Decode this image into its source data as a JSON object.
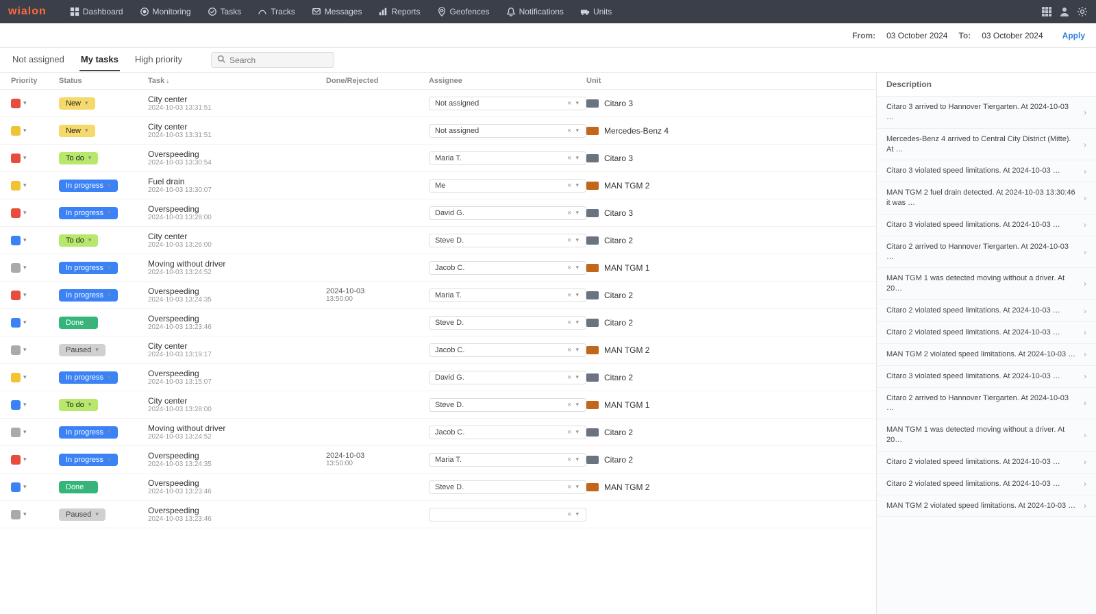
{
  "brand": "wialon",
  "nav": [
    {
      "label": "Dashboard"
    },
    {
      "label": "Monitoring"
    },
    {
      "label": "Tasks"
    },
    {
      "label": "Tracks"
    },
    {
      "label": "Messages"
    },
    {
      "label": "Reports"
    },
    {
      "label": "Geofences"
    },
    {
      "label": "Notifications"
    },
    {
      "label": "Units"
    }
  ],
  "datebar": {
    "from_label": "From:",
    "from_value": "03 October 2024",
    "to_label": "To:",
    "to_value": "03 October 2024",
    "apply": "Apply"
  },
  "tabs": {
    "not_assigned": "Not assigned",
    "my_tasks": "My tasks",
    "high_priority": "High priority"
  },
  "search_placeholder": "Search",
  "columns": {
    "priority": "Priority",
    "status": "Status",
    "task": "Task",
    "done": "Done/Rejected",
    "assignee": "Assignee",
    "unit": "Unit"
  },
  "status_labels": {
    "new": "New",
    "todo": "To do",
    "progress": "In progress",
    "done": "Done",
    "paused": "Paused"
  },
  "rows": [
    {
      "pri": "r",
      "status": "new",
      "task": "City center",
      "ts": "2024-10-03 13:31:51",
      "done": "",
      "assignee": "Not assigned",
      "unit": "Citaro 3",
      "uic": "bus"
    },
    {
      "pri": "y",
      "status": "new",
      "task": "City center",
      "ts": "2024-10-03 13:31:51",
      "done": "",
      "assignee": "Not assigned",
      "unit": "Mercedes-Benz 4",
      "uic": "van"
    },
    {
      "pri": "r",
      "status": "todo",
      "task": "Overspeeding",
      "ts": "2024-10-03 13:30:54",
      "done": "",
      "assignee": "Maria T.",
      "unit": "Citaro 3",
      "uic": "bus"
    },
    {
      "pri": "y",
      "status": "progress",
      "task": "Fuel drain",
      "ts": "2024-10-03 13:30:07",
      "done": "",
      "assignee": "Me",
      "unit": "MAN TGM 2",
      "uic": "van"
    },
    {
      "pri": "r",
      "status": "progress",
      "task": "Overspeeding",
      "ts": "2024-10-03 13:28:00",
      "done": "",
      "assignee": "David G.",
      "unit": "Citaro 3",
      "uic": "bus"
    },
    {
      "pri": "b",
      "status": "todo",
      "task": "City center",
      "ts": "2024-10-03 13:26:00",
      "done": "",
      "assignee": "Steve D.",
      "unit": "Citaro 2",
      "uic": "bus"
    },
    {
      "pri": "g",
      "status": "progress",
      "task": "Moving without driver",
      "ts": "2024-10-03 13:24:52",
      "done": "",
      "assignee": "Jacob C.",
      "unit": "MAN TGM 1",
      "uic": "van"
    },
    {
      "pri": "r",
      "status": "progress",
      "task": "Overspeeding",
      "ts": "2024-10-03 13:24:35",
      "done": "2024-10-03",
      "done2": "13:50:00",
      "assignee": "Maria T.",
      "unit": "Citaro 2",
      "uic": "bus"
    },
    {
      "pri": "b",
      "status": "done",
      "task": "Overspeeding",
      "ts": "2024-10-03 13:23:46",
      "done": "",
      "assignee": "Steve D.",
      "unit": "Citaro 2",
      "uic": "bus"
    },
    {
      "pri": "g",
      "status": "paused",
      "task": "City center",
      "ts": "2024-10-03 13:19:17",
      "done": "",
      "assignee": "Jacob C.",
      "unit": "MAN TGM 2",
      "uic": "van"
    },
    {
      "pri": "y",
      "status": "progress",
      "task": "Overspeeding",
      "ts": "2024-10-03 13:15:07",
      "done": "",
      "assignee": "David G.",
      "unit": "Citaro 2",
      "uic": "bus"
    },
    {
      "pri": "b",
      "status": "todo",
      "task": "City center",
      "ts": "2024-10-03 13:28:00",
      "done": "",
      "assignee": "Steve D.",
      "unit": "MAN TGM 1",
      "uic": "van"
    },
    {
      "pri": "g",
      "status": "progress",
      "task": "Moving without driver",
      "ts": "2024-10-03 13:24:52",
      "done": "",
      "assignee": "Jacob C.",
      "unit": "Citaro 2",
      "uic": "bus"
    },
    {
      "pri": "r",
      "status": "progress",
      "task": "Overspeeding",
      "ts": "2024-10-03 13:24:35",
      "done": "2024-10-03",
      "done2": "13:50:00",
      "assignee": "Maria T.",
      "unit": "Citaro 2",
      "uic": "bus"
    },
    {
      "pri": "b",
      "status": "done",
      "task": "Overspeeding",
      "ts": "2024-10-03 13:23:46",
      "done": "",
      "assignee": "Steve D.",
      "unit": "MAN TGM 2",
      "uic": "van"
    },
    {
      "pri": "g",
      "status": "paused",
      "task": "Overspeeding",
      "ts": "2024-10-03 13:23:46",
      "done": "",
      "assignee": "",
      "unit": "",
      "uic": "bus"
    }
  ],
  "side_header": "Description",
  "side": [
    {
      "t": "Citaro 3 arrived to Hannover Tiergarten. At 2024-10-03 …"
    },
    {
      "t": "Mercedes-Benz 4 arrived to Central City District (Mitte). At …"
    },
    {
      "t": "Citaro 3 violated speed limitations. At 2024-10-03 …"
    },
    {
      "t": "MAN TGM 2 fuel drain detected. At 2024-10-03 13:30:46 it was …"
    },
    {
      "t": "Citaro 3 violated speed limitations. At 2024-10-03 …"
    },
    {
      "t": "Citaro 2 arrived to Hannover Tiergarten. At 2024-10-03 …"
    },
    {
      "t": "MAN TGM 1 was detected moving without a driver. At 20…"
    },
    {
      "t": "Citaro 2 violated speed limitations. At 2024-10-03 …"
    },
    {
      "t": "Citaro 2 violated speed limitations. At 2024-10-03 …"
    },
    {
      "t": "MAN TGM 2 violated speed limitations. At 2024-10-03 …"
    },
    {
      "t": "Citaro 3 violated speed limitations. At 2024-10-03 …"
    },
    {
      "t": "Citaro 2 arrived to Hannover Tiergarten. At 2024-10-03 …"
    },
    {
      "t": "MAN TGM 1 was detected moving without a driver. At 20…"
    },
    {
      "t": "Citaro 2 violated speed limitations. At 2024-10-03 …"
    },
    {
      "t": "Citaro 2 violated speed limitations. At 2024-10-03 …"
    },
    {
      "t": "MAN TGM 2 violated speed limitations. At 2024-10-03 …"
    }
  ]
}
